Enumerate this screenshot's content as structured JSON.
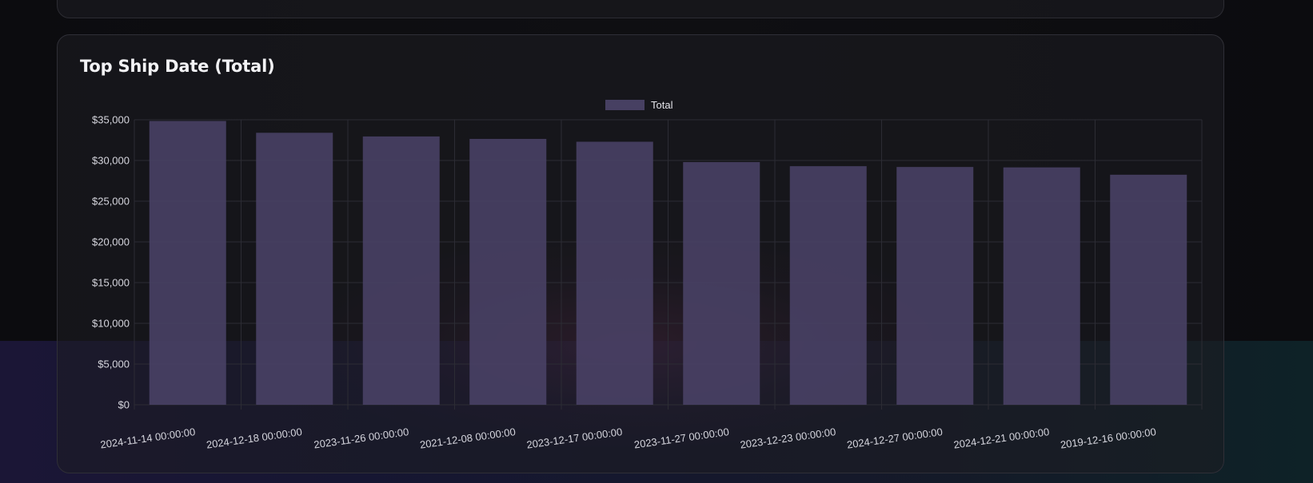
{
  "card": {
    "title": "Top Ship Date (Total)"
  },
  "colors": {
    "bar_fill": "#4a4266",
    "bar_fill_alpha": 0.88,
    "grid": "#2c2c34",
    "tick_text": "#d6d6de"
  },
  "chart_data": {
    "type": "bar",
    "title": "Top Ship Date (Total)",
    "legend": {
      "position": "top",
      "entries": [
        "Total"
      ]
    },
    "categories": [
      "2024-11-14 00:00:00",
      "2024-12-18 00:00:00",
      "2023-11-26 00:00:00",
      "2021-12-08 00:00:00",
      "2023-12-17 00:00:00",
      "2023-11-27 00:00:00",
      "2023-12-23 00:00:00",
      "2024-12-27 00:00:00",
      "2024-12-21 00:00:00",
      "2019-12-16 00:00:00"
    ],
    "series": [
      {
        "name": "Total",
        "values": [
          34850,
          33400,
          32950,
          32650,
          32300,
          29800,
          29300,
          29200,
          29150,
          28250
        ]
      }
    ],
    "ylim": [
      0,
      35000
    ],
    "yticks": [
      0,
      5000,
      10000,
      15000,
      20000,
      25000,
      30000,
      35000
    ],
    "ytick_labels": [
      "$0",
      "$5,000",
      "$10,000",
      "$15,000",
      "$20,000",
      "$25,000",
      "$30,000",
      "$35,000"
    ],
    "grid": true
  }
}
